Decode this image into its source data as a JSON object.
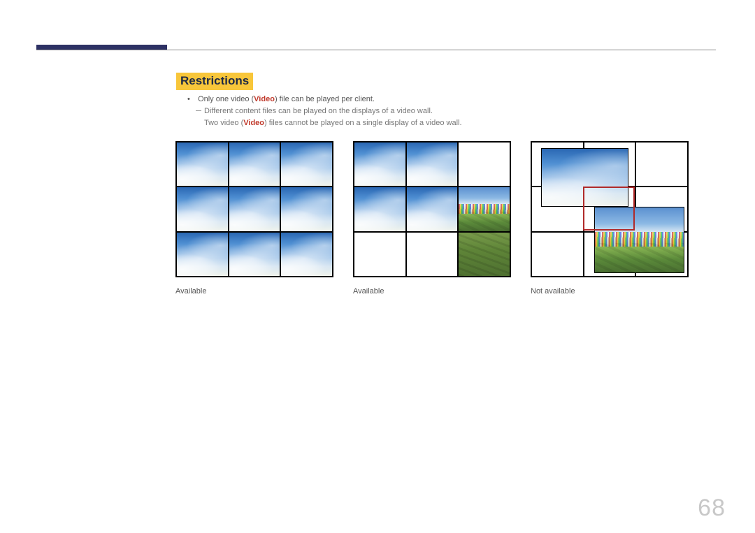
{
  "heading": "Restrictions",
  "bullet": {
    "pre": "Only one video (",
    "video": "Video",
    "post": ") file can be played per client."
  },
  "sub1": "Different content files can be played on the displays of a video wall.",
  "sub2": {
    "pre": "Two video (",
    "video": "Video",
    "post": ") files cannot be played on a single display of a video wall."
  },
  "captions": {
    "c1": "Available",
    "c2": "Available",
    "c3": "Not available"
  },
  "page_number": "68"
}
